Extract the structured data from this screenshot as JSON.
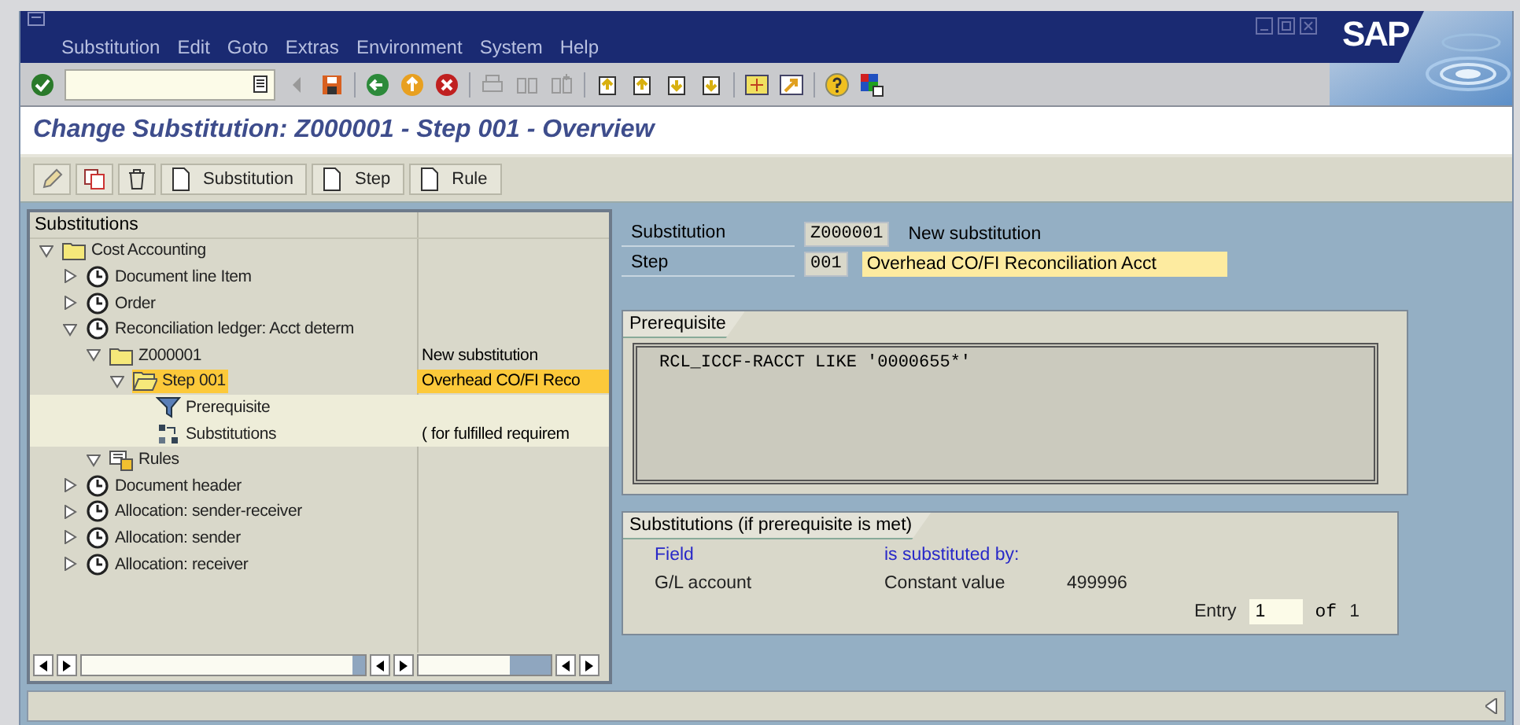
{
  "window": {
    "logo": "SAP"
  },
  "menu": [
    "Substitution",
    "Edit",
    "Goto",
    "Extras",
    "Environment",
    "System",
    "Help"
  ],
  "screen_title": "Change Substitution: Z000001 - Step 001 - Overview",
  "app_buttons": [
    {
      "label": "Substitution"
    },
    {
      "label": "Step"
    },
    {
      "label": "Rule"
    }
  ],
  "tree": {
    "header": "Substitutions",
    "nodes": [
      {
        "label": "Cost Accounting",
        "kind": "folder",
        "expanded": true,
        "selected": false,
        "children": [
          {
            "label": "Document line Item",
            "kind": "clock",
            "expanded": false,
            "selected": false
          },
          {
            "label": "Order",
            "kind": "clock",
            "expanded": false,
            "selected": false
          },
          {
            "label": "Reconciliation ledger: Acct determ",
            "kind": "clock",
            "expanded": true,
            "selected": false,
            "children": [
              {
                "label": "Z000001",
                "kind": "folder",
                "expanded": true,
                "selected": false,
                "description": "New substitution",
                "children": [
                  {
                    "label": "Step 001",
                    "kind": "open-folder",
                    "expanded": true,
                    "selected": true,
                    "description": "Overhead CO/FI Reco",
                    "children": [
                      {
                        "label": "Prerequisite",
                        "kind": "funnel",
                        "selected": false
                      },
                      {
                        "label": "Substitutions",
                        "kind": "swap",
                        "selected": false,
                        "description": "( for fulfilled requirem"
                      }
                    ]
                  }
                ]
              },
              {
                "label": "Rules",
                "kind": "rules",
                "expanded": true,
                "selected": false
              }
            ]
          },
          {
            "label": "Document header",
            "kind": "clock",
            "expanded": false,
            "selected": false
          },
          {
            "label": "Allocation: sender-receiver",
            "kind": "clock",
            "expanded": false,
            "selected": false
          },
          {
            "label": "Allocation: sender",
            "kind": "clock",
            "expanded": false,
            "selected": false
          },
          {
            "label": "Allocation: receiver",
            "kind": "clock",
            "expanded": false,
            "selected": false
          }
        ]
      }
    ]
  },
  "header_fields": [
    {
      "label": "Substitution",
      "value": "Z000001",
      "description": "New substitution",
      "highlighted": false
    },
    {
      "label": "Step",
      "value": "001",
      "description": "Overhead CO/FI Reconciliation Acct",
      "highlighted": true
    }
  ],
  "prerequisite": {
    "title": "Prerequisite",
    "text": "RCL_ICCF-RACCT LIKE '0000655*'"
  },
  "substitutions": {
    "title": "Substitutions (if prerequisite is met)",
    "columns": [
      "Field",
      "is substituted by:"
    ],
    "rows": [
      {
        "field": "G/L account",
        "method": "Constant value",
        "value": "499996"
      }
    ],
    "entry": {
      "label": "Entry",
      "value": "1",
      "of_label": "of",
      "total": "1"
    }
  }
}
